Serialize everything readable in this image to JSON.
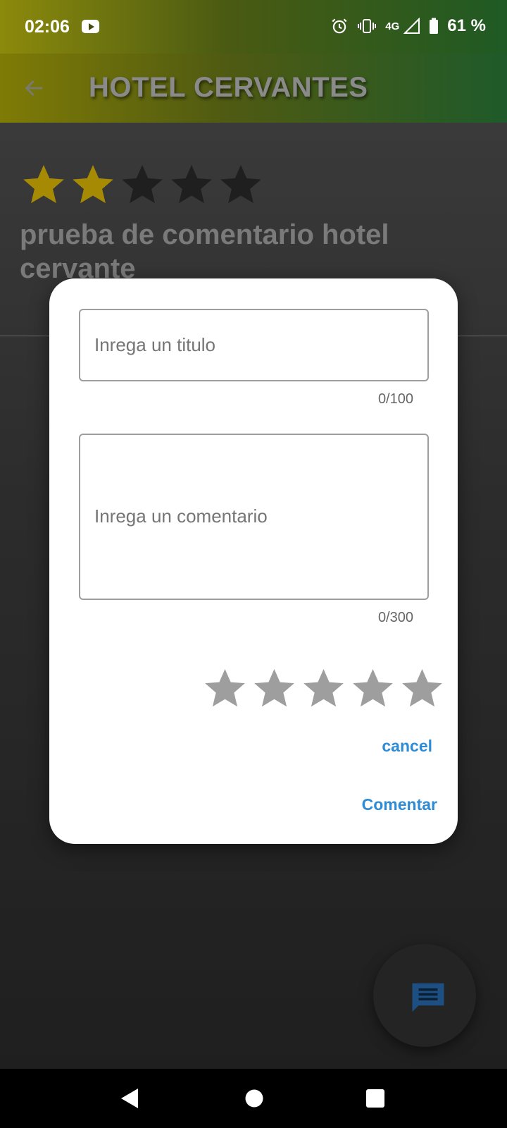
{
  "status_bar": {
    "time": "02:06",
    "network": "4G",
    "battery": "61 %",
    "icons": [
      "youtube-icon",
      "alarm-icon",
      "vibrate-icon",
      "signal-icon",
      "battery-icon"
    ]
  },
  "app_bar": {
    "title": "HOTEL CERVANTES",
    "back_icon": "arrow-back-icon"
  },
  "review": {
    "rating": 2,
    "max_rating": 5,
    "title": "prueba de comentario hotel cervante"
  },
  "dialog": {
    "title_field": {
      "placeholder": "Inrega un titulo",
      "value": "",
      "counter": "0/100"
    },
    "comment_field": {
      "placeholder": "Inrega un comentario",
      "value": "",
      "counter": "0/300"
    },
    "rating": {
      "value": 0,
      "max": 5
    },
    "cancel_label": "cancel",
    "submit_label": "Comentar"
  },
  "fab": {
    "icon": "comment-icon"
  },
  "nav_bar": {
    "icons": [
      "nav-back-icon",
      "nav-home-icon",
      "nav-recents-icon"
    ]
  },
  "colors": {
    "accent": "#2e8bd6",
    "star_filled": "#a68a04",
    "star_empty_bg": "#1f1f1f",
    "star_dialog": "#9e9e9e",
    "appbar_start": "#7f7b06",
    "appbar_end": "#1f5a2a"
  }
}
